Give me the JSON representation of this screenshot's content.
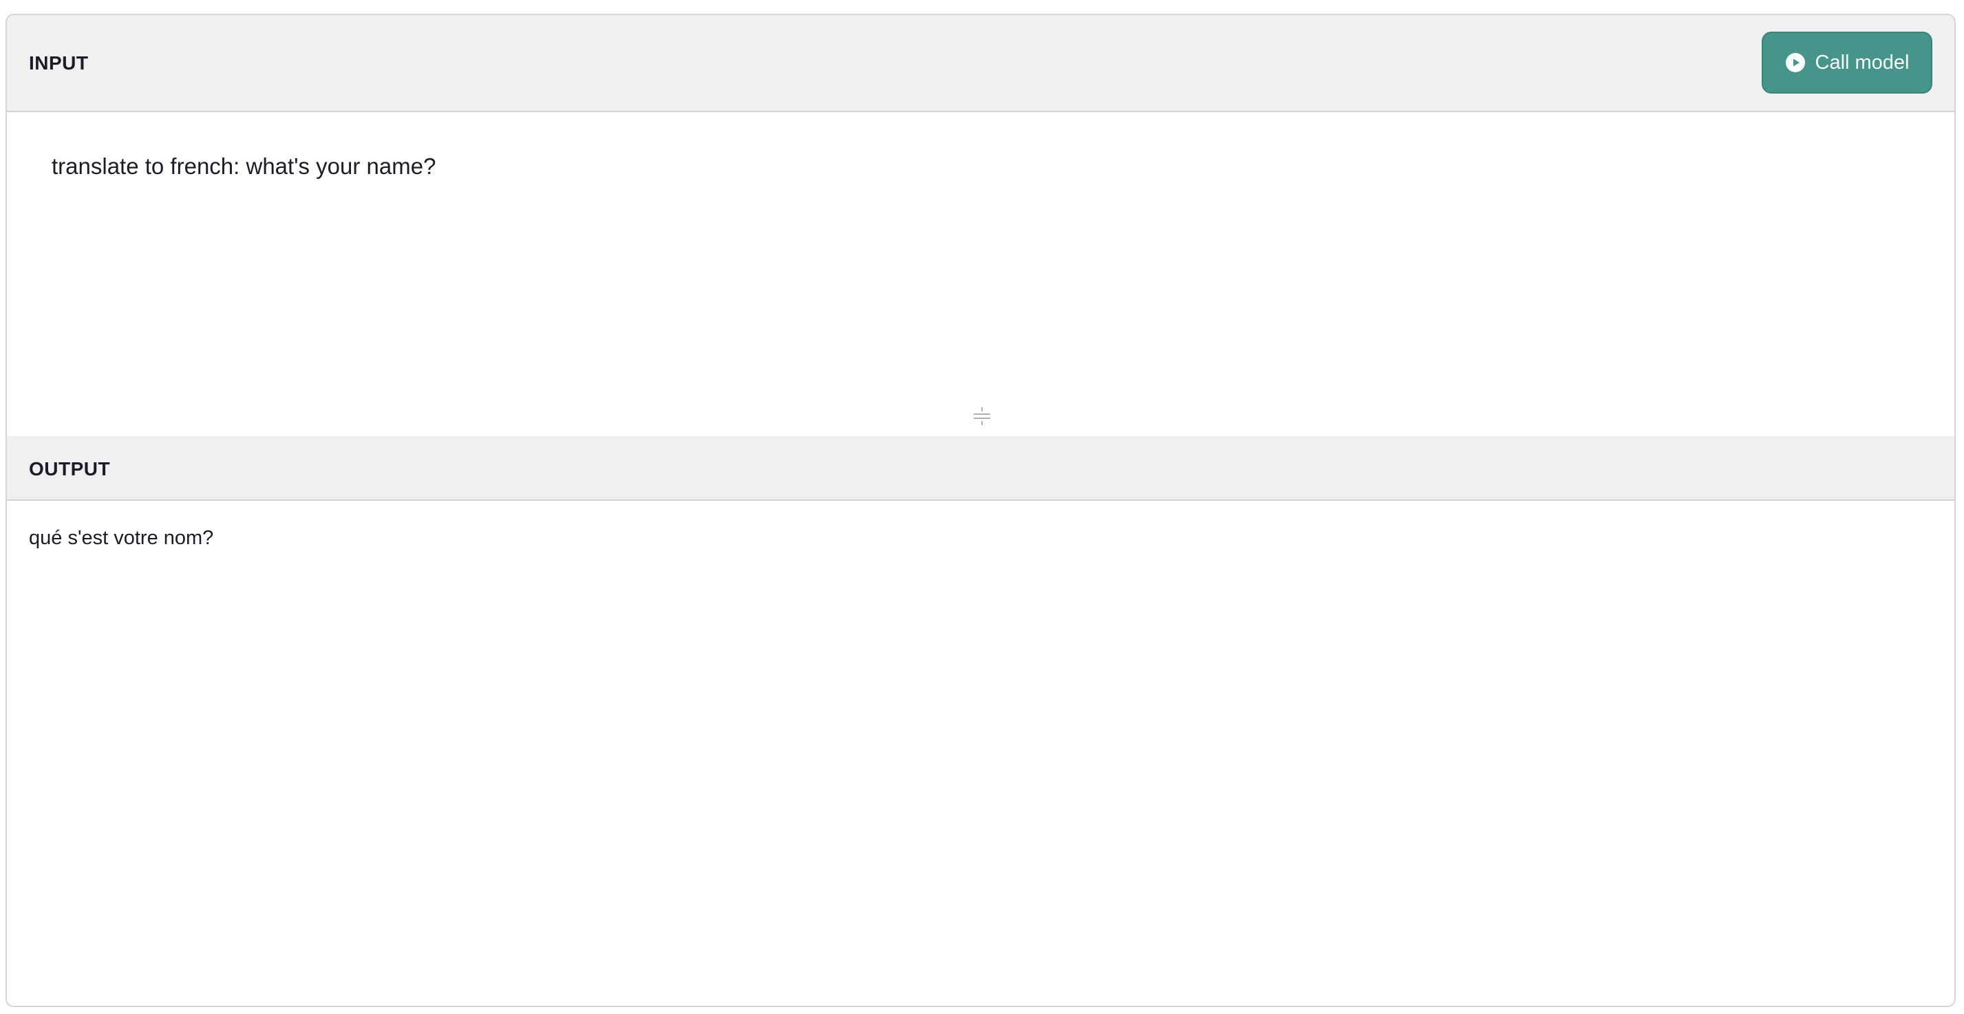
{
  "input": {
    "header_label": "INPUT",
    "text": "translate to french: what's your name?",
    "call_button_label": "Call model",
    "call_button_icon": "play-circle-icon",
    "resize_icon": "resize-handle-icon"
  },
  "output": {
    "header_label": "OUTPUT",
    "text": "qué s'est votre nom?"
  },
  "colors": {
    "accent": "#45958a",
    "header_bg": "#f0f0f0",
    "border": "#d6d6d6"
  }
}
